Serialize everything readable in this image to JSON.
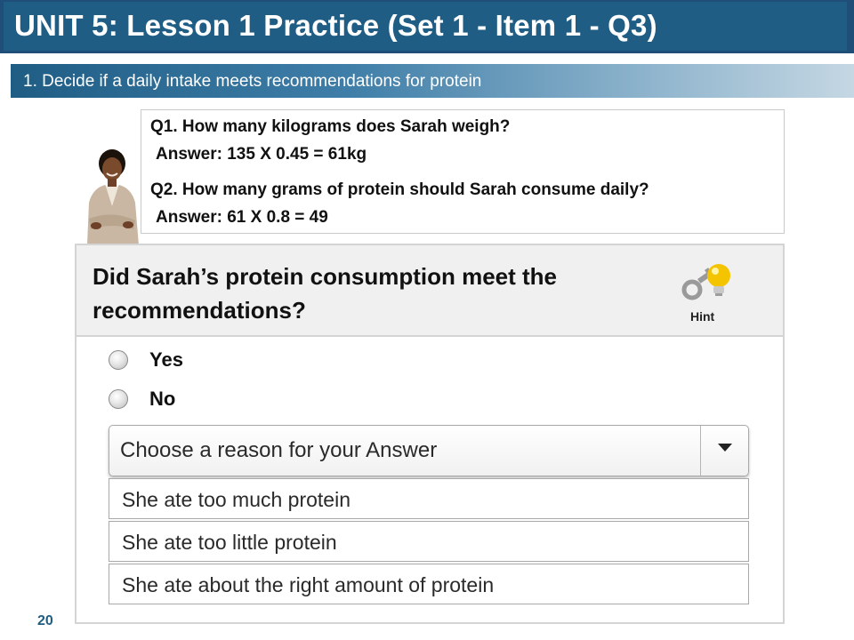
{
  "header": {
    "title": "UNIT 5: Lesson 1 Practice (Set 1 - Item 1 - Q3)",
    "subtitle": "1. Decide if a daily intake meets recommendations for protein"
  },
  "qa": {
    "q1": "Q1. How many kilograms does Sarah weigh?",
    "a1": "Answer: 135 X 0.45 = 61kg",
    "q2": "Q2. How many grams of protein should Sarah consume daily?",
    "a2": "Answer: 61 X 0.8 = 49"
  },
  "panel": {
    "question": "Did Sarah’s protein consumption meet the recommendations?",
    "hint_label": "Hint",
    "hint_icon": "key-lightbulb-icon",
    "options": [
      {
        "label": "Yes",
        "selected": false
      },
      {
        "label": "No",
        "selected": false
      }
    ],
    "dropdown": {
      "placeholder": "Choose a reason for your Answer",
      "items": [
        "She ate too much protein",
        "She ate too little protein",
        "She ate about the right amount of protein"
      ]
    }
  },
  "footer": {
    "page_number": "20"
  },
  "colors": {
    "title_bg": "#1f5d85",
    "page_number": "#1f5d85"
  }
}
